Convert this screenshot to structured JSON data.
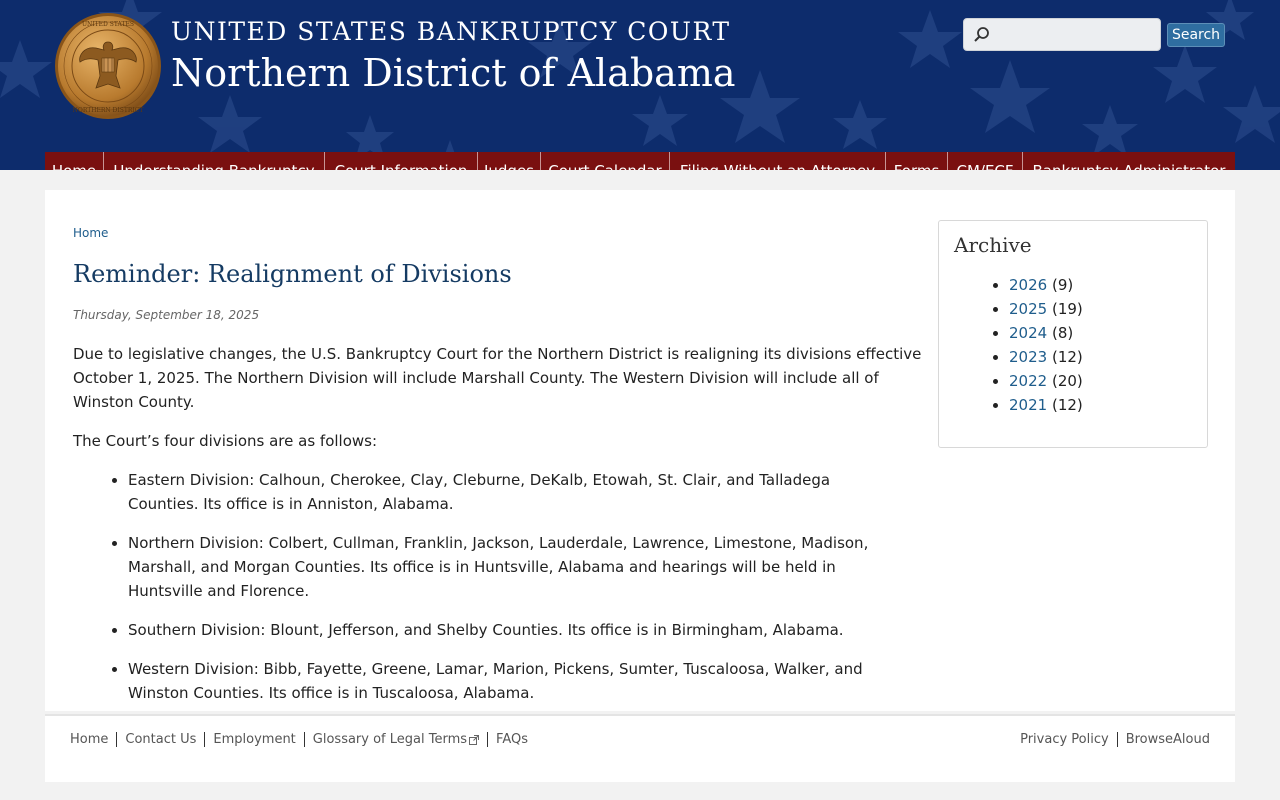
{
  "header": {
    "court_line1": "UNITED STATES BANKRUPTCY COURT",
    "court_line2": "Northern District of Alabama",
    "seal_name": "court-seal",
    "search": {
      "placeholder": "",
      "value": "",
      "button_label": "Search"
    },
    "brand_colors": {
      "header_bg": "#0d2c6c",
      "nav_bg": "#7a1010",
      "link": "#1f5d8c"
    }
  },
  "nav": {
    "items": [
      {
        "label": "Home"
      },
      {
        "label": "Understanding Bankruptcy"
      },
      {
        "label": "Court Information"
      },
      {
        "label": "Judges"
      },
      {
        "label": "Court Calendar"
      },
      {
        "label": "Filing Without an Attorney"
      },
      {
        "label": "Forms"
      },
      {
        "label": "CM/ECF"
      },
      {
        "label": "Bankruptcy Administrator"
      }
    ]
  },
  "breadcrumb": {
    "home": "Home"
  },
  "article": {
    "title": "Reminder: Realignment of Divisions",
    "date": "Thursday, September 18, 2025",
    "paragraph1": "Due to legislative changes, the U.S. Bankruptcy Court for the Northern District is realigning its divisions effective October 1, 2025. The Northern Division will include Marshall County. The Western Division will include all of Winston County.",
    "paragraph2": "The Court’s four divisions are as follows:",
    "divisions": [
      "Eastern Division: Calhoun, Cherokee, Clay, Cleburne, DeKalb, Etowah, St. Clair, and Talladega Counties. Its office is in Anniston, Alabama.",
      "Northern Division: Colbert, Cullman, Franklin, Jackson, Lauderdale, Lawrence, Limestone, Madison, Marshall, and Morgan Counties. Its office is in Huntsville, Alabama and hearings will be held in Huntsville and Florence.",
      "Southern Division: Blount, Jefferson, and Shelby Counties. Its office is in Birmingham, Alabama.",
      "Western Division: Bibb, Fayette, Greene, Lamar, Marion, Pickens, Sumter, Tuscaloosa, Walker, and Winston Counties. Its office is in Tuscaloosa, Alabama."
    ]
  },
  "sidebar": {
    "title": "Archive",
    "years": [
      {
        "year": "2026",
        "count": "(9)"
      },
      {
        "year": "2025",
        "count": "(19)"
      },
      {
        "year": "2024",
        "count": "(8)"
      },
      {
        "year": "2023",
        "count": "(12)"
      },
      {
        "year": "2022",
        "count": "(20)"
      },
      {
        "year": "2021",
        "count": "(12)"
      }
    ]
  },
  "footer": {
    "left_links": [
      "Home",
      "Contact Us",
      "Employment",
      "Glossary of Legal Terms",
      "FAQs"
    ],
    "right_links": [
      "Privacy Policy",
      "BrowseAloud"
    ]
  }
}
